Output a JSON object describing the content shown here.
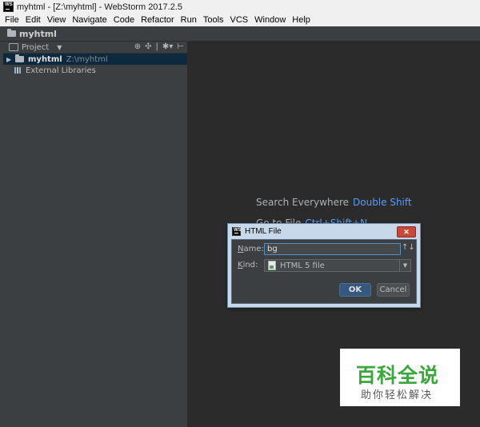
{
  "window": {
    "title": "myhtml - [Z:\\myhtml] - WebStorm 2017.2.5"
  },
  "menu": [
    "File",
    "Edit",
    "View",
    "Navigate",
    "Code",
    "Refactor",
    "Run",
    "Tools",
    "VCS",
    "Window",
    "Help"
  ],
  "navbar": {
    "crumb": "myhtml"
  },
  "project_panel": {
    "title": "Project",
    "tree": [
      {
        "name": "myhtml",
        "path": "Z:\\myhtml"
      },
      {
        "name": "External Libraries"
      }
    ]
  },
  "editor_hints": [
    {
      "text": "Search Everywhere",
      "key": "Double Shift"
    },
    {
      "text": "Go to File",
      "key": "Ctrl+Shift+N"
    }
  ],
  "dialog": {
    "title": "HTML File",
    "name_label_u": "N",
    "name_label_rest": "ame:",
    "name_value": "bg",
    "kind_label_u": "K",
    "kind_label_rest": "ind:",
    "kind_value": "HTML 5 file",
    "ok_label": "OK",
    "cancel_label": "Cancel",
    "close_glyph": "✕",
    "sort_glyph": "↑↓"
  },
  "watermark": {
    "big": "百科全说",
    "small": "助你轻松解决"
  },
  "colors": {
    "accent": "#589df6",
    "selection": "#0d293e",
    "ok_button": "#365880"
  }
}
